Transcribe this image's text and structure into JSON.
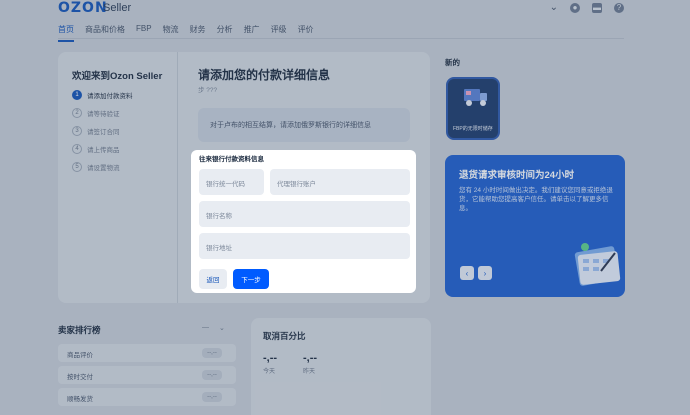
{
  "header": {
    "logo": "OZON",
    "logo_sub": "Seller",
    "nav": [
      "首页",
      "商品和价格",
      "FBP",
      "物流",
      "财务",
      "分析",
      "推广",
      "评级",
      "评价"
    ]
  },
  "onboarding": {
    "welcome": "欢迎来到Ozon Seller",
    "steps": [
      {
        "num": "1",
        "label": "请添加付款资料"
      },
      {
        "num": "2",
        "label": "请等待验证"
      },
      {
        "num": "3",
        "label": "请签订合同"
      },
      {
        "num": "4",
        "label": "请上传商品"
      },
      {
        "num": "5",
        "label": "请设置物流"
      }
    ],
    "heading": "请添加您的付款详细信息",
    "step_counter": "步 ???",
    "info": "对于卢布的相互结算，请添加俄罗斯银行的详细信息"
  },
  "popup": {
    "title": "往来银行付款资料信息",
    "bank_code_placeholder": "银行统一代码",
    "agent_account_placeholder": "代理银行账户",
    "bank_name_placeholder": "银行名称",
    "bank_address_placeholder": "银行地址",
    "back_label": "返回",
    "next_label": "下一步"
  },
  "sidebar_right": {
    "new_label": "新的",
    "tile_text": "FBP的无限时储存",
    "promo_title": "退货请求审核时间为24小时",
    "promo_text": "您有 24 小时时间做出决定。我们建议您同意或拒绝退货，它能帮助您提高客户信任。请单击以了解更多信息。",
    "prev_icon": "chevron-left",
    "next_icon": "chevron-right"
  },
  "ranking": {
    "title": "卖家排行榜",
    "rows": [
      {
        "label": "商品评价",
        "value": "--,--"
      },
      {
        "label": "按时交付",
        "value": "--,--"
      },
      {
        "label": "顺畅发货",
        "value": "--,--"
      }
    ]
  },
  "cancel": {
    "title": "取消百分比",
    "today_value": "-,--",
    "today_label": "今天",
    "yesterday_value": "-,--",
    "yesterday_label": "昨天"
  },
  "colors": {
    "accent": "#005bff",
    "brand": "#1454b8",
    "promo": "#1f5fcf"
  }
}
